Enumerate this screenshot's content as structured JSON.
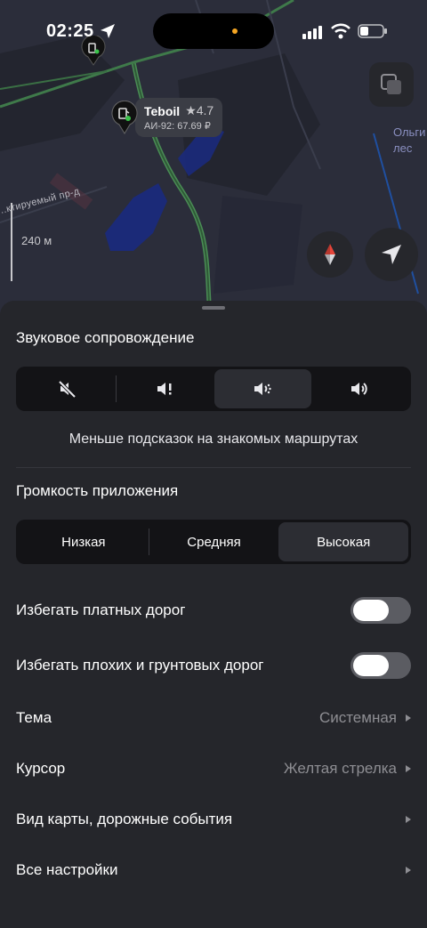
{
  "status_bar": {
    "time": "02:25",
    "icons": [
      "location-arrow-icon",
      "signal-icon",
      "wifi-icon",
      "battery-icon"
    ]
  },
  "map": {
    "poi": {
      "name": "Teboil",
      "rating": "★4.7",
      "price": "АИ-92: 67.69 ₽",
      "icon": "gas-station-icon"
    },
    "scale_label": "240 м",
    "street_label": "...ктируемый пр-д",
    "place_label_line1": "Ольги",
    "place_label_line2": "лес",
    "buttons": [
      "layers-icon",
      "compass-icon",
      "navigation-arrow-icon"
    ]
  },
  "sound": {
    "title": "Звуковое сопровождение",
    "options": [
      "sound-off-icon",
      "sound-important-icon",
      "sound-reduced-icon",
      "sound-full-icon"
    ],
    "selected_index": 2,
    "hint": "Меньше подсказок на знакомых маршрутах"
  },
  "volume": {
    "title": "Громкость приложения",
    "options": [
      "Низкая",
      "Средняя",
      "Высокая"
    ],
    "selected": "Высокая"
  },
  "toggles": {
    "toll_roads": {
      "label": "Избегать платных дорог",
      "on": false
    },
    "bad_roads": {
      "label": "Избегать плохих и грунтовых дорог",
      "on": false
    }
  },
  "settings_rows": {
    "theme": {
      "label": "Тема",
      "value": "Системная"
    },
    "cursor": {
      "label": "Курсор",
      "value": "Желтая стрелка"
    },
    "map_view": {
      "label": "Вид карты, дорожные события",
      "value": ""
    },
    "all": {
      "label": "Все настройки",
      "value": ""
    }
  },
  "colors": {
    "sheet_bg": "#25262b",
    "segment_bg": "#131316",
    "segment_selected": "#2c2d33",
    "secondary_text": "#8e8e93",
    "map_road_green": "#4a8c55",
    "map_water": "#1a2a80"
  }
}
